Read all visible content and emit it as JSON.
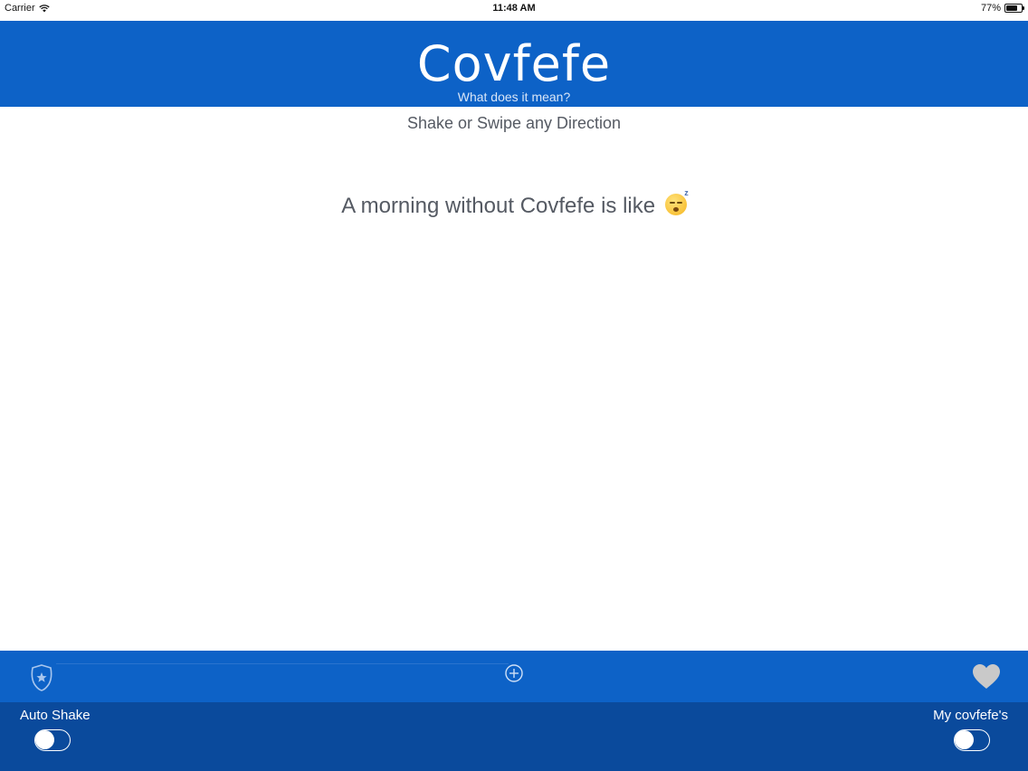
{
  "status_bar": {
    "carrier": "Carrier",
    "time": "11:48 AM",
    "battery_text": "77%",
    "battery_level": 0.77,
    "wifi_icon": "wifi-icon"
  },
  "header": {
    "title": "Covfefe",
    "subtitle": "What does it mean?",
    "background": "#0d62c7"
  },
  "main": {
    "instruction": "Shake or Swipe any Direction",
    "phrase": "A morning without Covfefe is like",
    "phrase_emoji": "sleeping-face-emoji"
  },
  "toolbar": {
    "left_icon": "police-badge-icon",
    "center_icon": "add-circle-icon",
    "right_icon": "heart-icon"
  },
  "controls": {
    "auto_shake": {
      "label": "Auto Shake",
      "on": false
    },
    "my_covfefes": {
      "label": "My covfefe's",
      "on": false
    },
    "background": "#0a4a9c"
  }
}
